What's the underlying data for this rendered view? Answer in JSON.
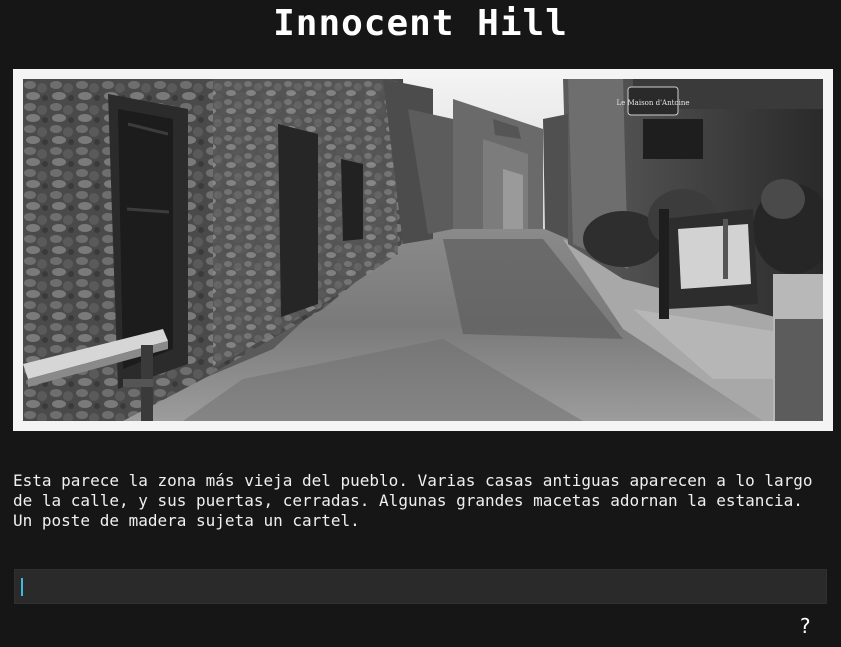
{
  "game": {
    "title": "Innocent Hill"
  },
  "scene": {
    "sign_text": "Le Maison d'Antoine"
  },
  "narration": {
    "text": "Esta parece la zona más vieja del pueblo. Varias casas antiguas aparecen a lo largo de la calle, y sus puertas, cerradas. Algunas grandes macetas adornan la estancia. Un poste de madera sujeta un cartel."
  },
  "command": {
    "value": "",
    "placeholder": ""
  },
  "help": {
    "label": "?"
  },
  "colors": {
    "background": "#161616",
    "frame": "#f4f4f4",
    "input_bg": "#2a2a2a",
    "caret": "#3fb8e8"
  }
}
